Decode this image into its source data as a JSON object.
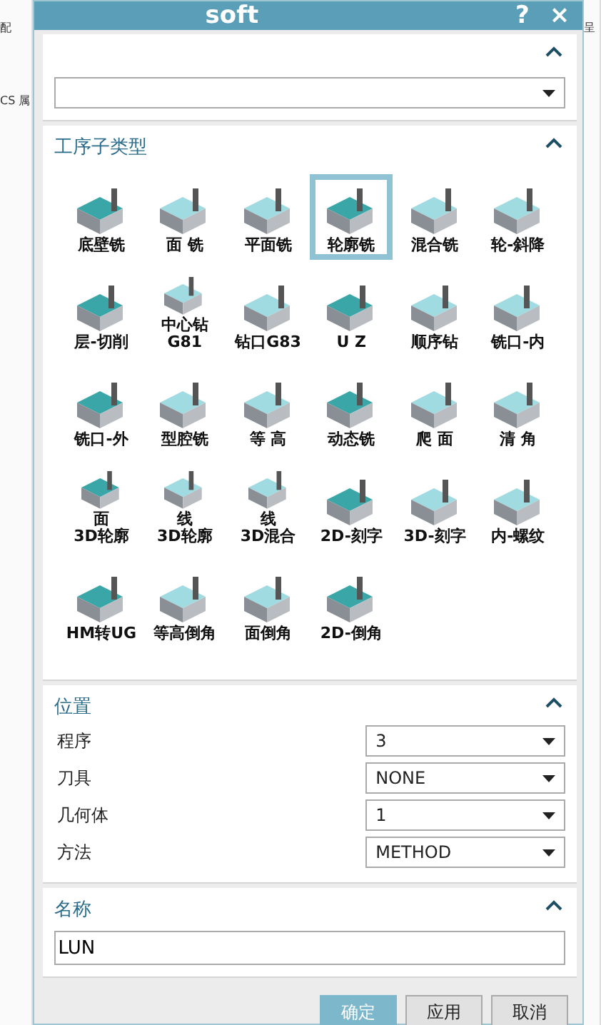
{
  "background": {
    "left_texts": [
      "配",
      "CS 属"
    ],
    "right_texts": [
      "呈"
    ]
  },
  "window": {
    "title": "soft",
    "help": "?",
    "close": "×"
  },
  "type_section": {
    "expanded": true
  },
  "subtype_section": {
    "title": "工序子类型",
    "expanded": true,
    "items": [
      {
        "label": "底壁铣",
        "selected": false
      },
      {
        "label": "面 铣",
        "selected": false
      },
      {
        "label": "平面铣",
        "selected": false
      },
      {
        "label": "轮廓铣",
        "selected": true
      },
      {
        "label": "混合铣",
        "selected": false
      },
      {
        "label": "轮-斜降",
        "selected": false
      },
      {
        "label": "层-切削",
        "selected": false
      },
      {
        "label": "中心钻G81",
        "selected": false
      },
      {
        "label": "钻口G83",
        "selected": false
      },
      {
        "label": "U Z",
        "selected": false
      },
      {
        "label": "顺序钻",
        "selected": false
      },
      {
        "label": "铣口-内",
        "selected": false
      },
      {
        "label": "铣口-外",
        "selected": false
      },
      {
        "label": "型腔铣",
        "selected": false
      },
      {
        "label": "等 高",
        "selected": false
      },
      {
        "label": "动态铣",
        "selected": false
      },
      {
        "label": "爬 面",
        "selected": false
      },
      {
        "label": "清 角",
        "selected": false
      },
      {
        "label": "面\n3D轮廓",
        "selected": false
      },
      {
        "label": "线\n3D轮廓",
        "selected": false
      },
      {
        "label": "线\n3D混合",
        "selected": false
      },
      {
        "label": "2D-刻字",
        "selected": false
      },
      {
        "label": "3D-刻字",
        "selected": false
      },
      {
        "label": "内-螺纹",
        "selected": false
      },
      {
        "label": "HM转UG",
        "selected": false
      },
      {
        "label": "等高倒角",
        "selected": false
      },
      {
        "label": "面倒角",
        "selected": false
      },
      {
        "label": "2D-倒角",
        "selected": false
      }
    ]
  },
  "location_section": {
    "title": "位置",
    "expanded": true,
    "fields": [
      {
        "label": "程序",
        "value": "3"
      },
      {
        "label": "刀具",
        "value": "NONE"
      },
      {
        "label": "几何体",
        "value": "1"
      },
      {
        "label": "方法",
        "value": "METHOD"
      }
    ]
  },
  "name_section": {
    "title": "名称",
    "expanded": true,
    "value": "LUN"
  },
  "buttons": [
    {
      "label": "确定",
      "kind": "primary"
    },
    {
      "label": "应用",
      "kind": "normal"
    },
    {
      "label": "取消",
      "kind": "normal"
    }
  ]
}
